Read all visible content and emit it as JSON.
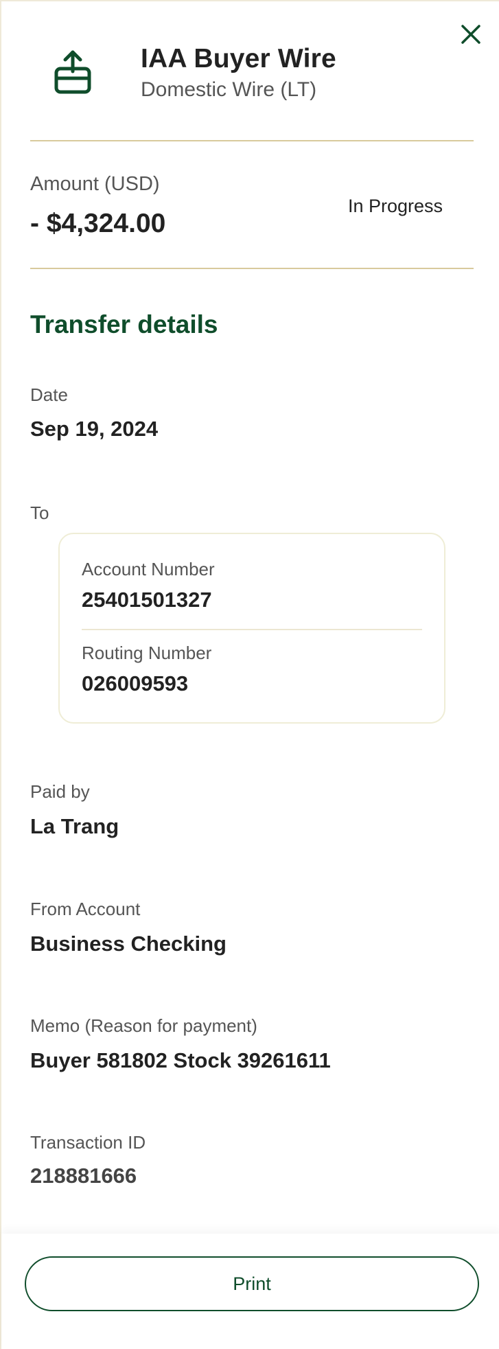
{
  "header": {
    "title": "IAA Buyer Wire",
    "subtitle": "Domestic Wire (LT)",
    "icon": "upload-tray-icon",
    "close_icon": "close-icon"
  },
  "amount": {
    "label": "Amount (USD)",
    "value": "- $4,324.00",
    "status": "In Progress"
  },
  "transfer_details": {
    "title": "Transfer details",
    "date": {
      "label": "Date",
      "value": "Sep 19, 2024"
    },
    "to": {
      "label": "To",
      "account_number": {
        "label": "Account Number",
        "value": "25401501327"
      },
      "routing_number": {
        "label": "Routing Number",
        "value": "026009593"
      }
    },
    "paid_by": {
      "label": "Paid by",
      "value": "La Trang"
    },
    "from_account": {
      "label": "From Account",
      "value": "Business Checking"
    },
    "memo": {
      "label": "Memo (Reason for payment)",
      "value": "Buyer 581802 Stock 39261611"
    },
    "transaction_id": {
      "label": "Transaction ID",
      "value": "218881666"
    }
  },
  "footer": {
    "print_label": "Print"
  },
  "colors": {
    "brand_green": "#0f4d2b",
    "divider_gold": "#d8ca9c",
    "text_dark": "#222222",
    "text_muted": "#555555"
  }
}
